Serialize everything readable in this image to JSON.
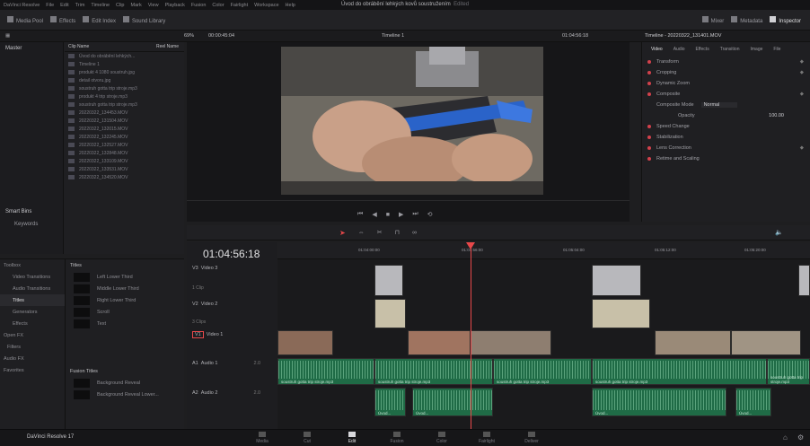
{
  "app": {
    "menu": [
      "DaVinci Resolve",
      "File",
      "Edit",
      "Trim",
      "Timeline",
      "Clip",
      "Mark",
      "View",
      "Playback",
      "Fusion",
      "Color",
      "Fairlight",
      "Workspace",
      "Help"
    ],
    "document_title": "Úvod do obrábění lehkých kovů soustružením",
    "document_status": "Edited"
  },
  "toolbar": {
    "media_pool": "Media Pool",
    "effects": "Effects",
    "edit_index": "Edit Index",
    "sound_library": "Sound Library",
    "mixer": "Mixer",
    "metadata": "Metadata",
    "inspector": "Inspector"
  },
  "subbar": {
    "zoom": "69%",
    "timecode_left": "00:00:45:04",
    "timeline_name": "Timeline 1",
    "timecode_right": "01:04:56:18",
    "inspector_title": "Timeline - 20220322_131401.MOV"
  },
  "mediapool": {
    "bin": "Master",
    "column_header": "Clip Name",
    "column_header_right": "Reel Name",
    "clips": [
      "Úvod do obrábění lehkých...",
      "Timeline 1",
      "produkt 4 1080 soustruh.jpg",
      "detail otvoru.jpg",
      "soustruh gotta trip stroje.mp3",
      "produkt 4 trip stroje.mp3",
      "soustruh gotta trip stroje.mp3",
      "20220322_134453.MOV",
      "20220322_131504.MOV",
      "20220322_132015.MOV",
      "20220322_132245.MOV",
      "20220322_132527.MOV",
      "20220322_132848.MOV",
      "20220322_133109.MOV",
      "20220322_133531.MOV",
      "20220322_134520.MOV"
    ],
    "smart_bins": "Smart Bins",
    "keywords": "Keywords"
  },
  "inspector": {
    "tabs": [
      "Video",
      "Audio",
      "Effects",
      "Transition",
      "Image",
      "File"
    ],
    "sections": [
      "Transform",
      "Cropping",
      "Dynamic Zoom",
      "Composite",
      "Speed Change",
      "Stabilization",
      "Lens Correction",
      "Retime and Scaling"
    ],
    "composite_mode_label": "Composite Mode",
    "composite_mode_value": "Normal",
    "opacity_label": "Opacity",
    "opacity_value": "100.00"
  },
  "effects": {
    "toolbox": "Toolbox",
    "items": [
      "Video Transitions",
      "Audio Transitions",
      "Titles",
      "Generators",
      "Effects"
    ],
    "openfx": "Open FX",
    "filters": "Filters",
    "audio_fx": "Audio FX",
    "favorites": "Favorites",
    "titles_header": "Titles",
    "titles": [
      "Left Lower Third",
      "Middle Lower Third",
      "Right Lower Third",
      "Scroll",
      "Text"
    ],
    "fusion_titles_header": "Fusion Titles",
    "fusion_titles": [
      "Background Reveal",
      "Background Reveal Lower..."
    ]
  },
  "timeline": {
    "timecode": "01:04:56:18",
    "ruler": [
      "01:04:00:00",
      "01:04:56:00",
      "01:05:04:00",
      "01:05:12:00",
      "01:05:20:00"
    ],
    "tracks": [
      {
        "id": "V3",
        "name": "Video 3",
        "info": "1 Clip"
      },
      {
        "id": "V2",
        "name": "Video 2",
        "info": "3 Clips"
      },
      {
        "id": "V1",
        "name": "Video 1",
        "info": ""
      },
      {
        "id": "A1",
        "name": "Audio 1",
        "info": "2.0"
      },
      {
        "id": "A2",
        "name": "Audio 2",
        "info": "2.0"
      }
    ],
    "audio_clip_labels": [
      "soustruh gotta trip stroje.mp3",
      "soustruh gotta trip stroje.mp3",
      "soustruh gotta trip stroje.mp3",
      "soustruh gotta trip stroje.mp3",
      "soustruh gotta trip stroje.mp3"
    ],
    "a2_labels": [
      "Úvod...",
      "Úvod...",
      "Úvod...",
      "Úvod..."
    ]
  },
  "pages": {
    "brand": "DaVinci Resolve 17",
    "tabs": [
      "Media",
      "Cut",
      "Edit",
      "Fusion",
      "Color",
      "Fairlight",
      "Deliver"
    ],
    "active": "Edit"
  },
  "colors": {
    "accent_red": "#e8484a",
    "audio_green": "#1f6b46",
    "video_clip": "#6a6a70"
  }
}
